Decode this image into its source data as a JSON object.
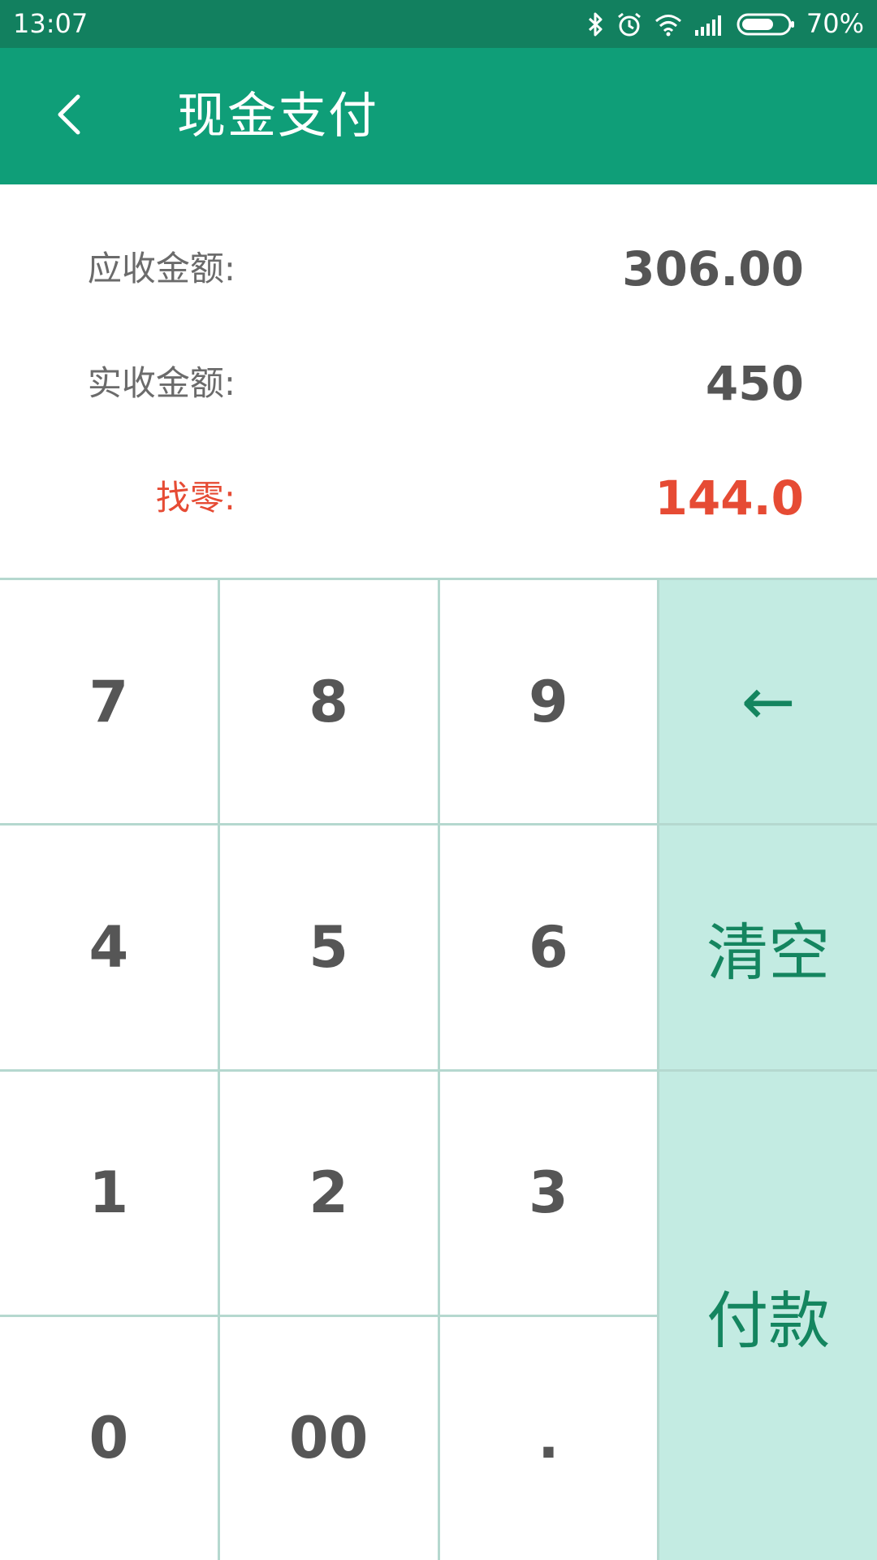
{
  "status_bar": {
    "time": "13:07",
    "battery_percent": "70%",
    "icons": [
      "bluetooth-icon",
      "alarm-icon",
      "wifi-icon",
      "signal-icon",
      "battery-icon"
    ],
    "battery_level": 0.7
  },
  "app_bar": {
    "title": "现金支付",
    "back_icon": "chevron-left-icon"
  },
  "summary": {
    "receivable_label": "应收金额:",
    "receivable_value": "306.00",
    "received_label": "实收金额:",
    "received_value": "450",
    "change_label": "找零:",
    "change_value": "144.0"
  },
  "keypad": {
    "k7": "7",
    "k8": "8",
    "k9": "9",
    "backspace": "←",
    "k4": "4",
    "k5": "5",
    "k6": "6",
    "clear": "清空",
    "k1": "1",
    "k2": "2",
    "k3": "3",
    "pay": "付款",
    "k0": "0",
    "k00": "00",
    "dot": "."
  },
  "colors": {
    "status_bar": "#12805f",
    "app_bar": "#0f9e78",
    "accent_text": "#14855f",
    "action_key_bg": "#c3ebe2",
    "change_red": "#e64b34",
    "grid_line": "#b5d8cf"
  }
}
